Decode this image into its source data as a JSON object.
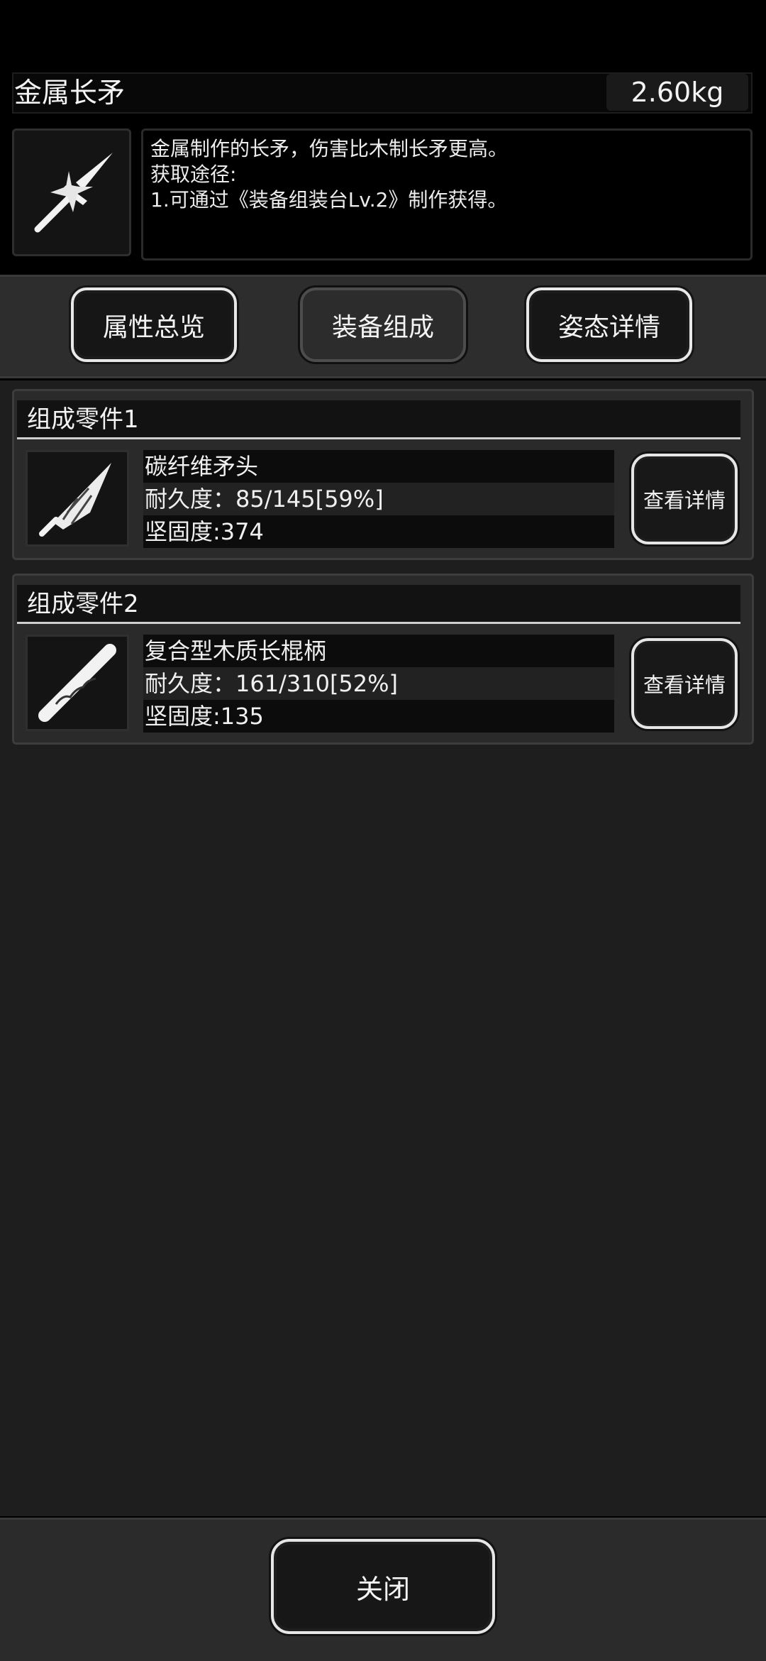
{
  "item": {
    "name": "金属长矛",
    "weight": "2.60kg",
    "icon": "spear-icon",
    "description": [
      "金属制作的长矛，伤害比木制长矛更高。",
      "获取途径:",
      "1.可通过《装备组装台Lv.2》制作获得。"
    ]
  },
  "tabs": [
    {
      "label": "属性总览",
      "active": false
    },
    {
      "label": "装备组成",
      "active": true
    },
    {
      "label": "姿态详情",
      "active": false
    }
  ],
  "parts": [
    {
      "header": "组成零件1",
      "icon": "spearhead-icon",
      "name": "碳纤维矛头",
      "durability": "耐久度：85/145[59%]",
      "firmness": "坚固度:374",
      "button": "查看详情"
    },
    {
      "header": "组成零件2",
      "icon": "staff-handle-icon",
      "name": "复合型木质长棍柄",
      "durability": "耐久度：161/310[52%]",
      "firmness": "坚固度:135",
      "button": "查看详情"
    }
  ],
  "footer": {
    "close_label": "关闭"
  },
  "colors": {
    "background": "#000000",
    "panel": "#1e1e1e",
    "card": "#2a2a2a",
    "text": "#f2f2f2"
  }
}
